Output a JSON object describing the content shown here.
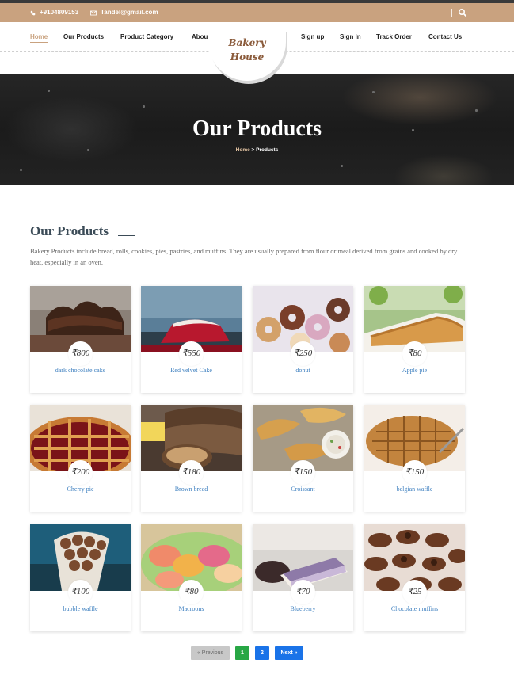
{
  "topbar": {
    "phone": "+9104809153",
    "email": "Tandel@gmail.com"
  },
  "nav": {
    "items": [
      "Home",
      "Our Products",
      "Product Category",
      "About Us",
      "Sign up",
      "Sign In",
      "Track Order",
      "Contact Us"
    ],
    "active": "Home"
  },
  "logo": {
    "line1": "Bakery",
    "line2": "House"
  },
  "hero": {
    "title": "Our Products",
    "breadcrumb_home": "Home",
    "breadcrumb_sep": ">",
    "breadcrumb_current": "Products"
  },
  "section": {
    "title": "Our Products",
    "description": "Bakery Products include bread, rolls, cookies, pies, pastries, and muffins. They are usually prepared from flour or meal derived from grains and cooked by dry heat, especially in an oven."
  },
  "products": [
    {
      "name": "dark chocolate cake",
      "price": "₹800"
    },
    {
      "name": "Red velvet Cake",
      "price": "₹550"
    },
    {
      "name": "donut",
      "price": "₹250"
    },
    {
      "name": "Apple pie",
      "price": "₹80"
    },
    {
      "name": "Cherry pie",
      "price": "₹200"
    },
    {
      "name": "Brown bread",
      "price": "₹180"
    },
    {
      "name": "Croissant",
      "price": "₹150"
    },
    {
      "name": "belgian waffle",
      "price": "₹150"
    },
    {
      "name": "bubble waffle",
      "price": "₹100"
    },
    {
      "name": "Macroons",
      "price": "₹80"
    },
    {
      "name": "Blueberry",
      "price": "₹70"
    },
    {
      "name": "Chocolate muffins",
      "price": "₹25"
    }
  ],
  "pagination": {
    "prev": "« Previous",
    "pages": [
      "1",
      "2"
    ],
    "current": "1",
    "next": "Next »"
  },
  "colors": {
    "accent": "#c9a27f",
    "heading": "#3b4b57",
    "link": "#3d7fbf",
    "page_active": "#28a745",
    "page_link": "#1a73e8"
  },
  "icons": {
    "phone": "phone-icon",
    "email": "envelope-icon",
    "search": "search-icon"
  }
}
